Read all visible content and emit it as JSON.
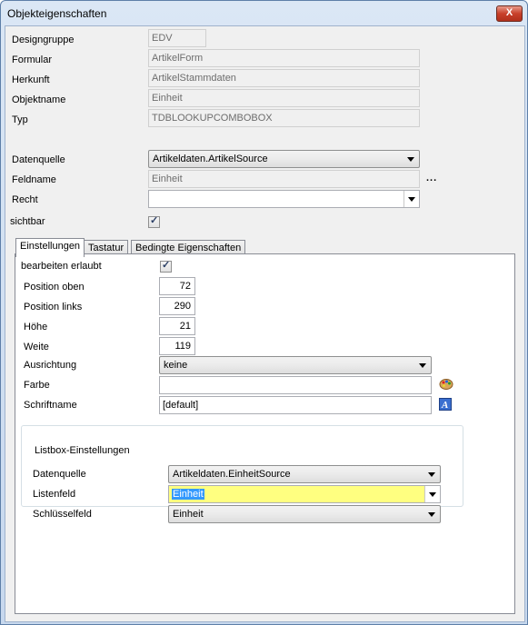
{
  "window": {
    "title": "Objekteigenschaften",
    "close": "X"
  },
  "props": {
    "designgruppe": {
      "label": "Designgruppe",
      "value": "EDV"
    },
    "formular": {
      "label": "Formular",
      "value": "ArtikelForm"
    },
    "herkunft": {
      "label": "Herkunft",
      "value": "ArtikelStammdaten"
    },
    "objektname": {
      "label": "Objektname",
      "value": "Einheit"
    },
    "typ": {
      "label": "Typ",
      "value": "TDBLOOKUPCOMBOBOX"
    },
    "datenquelle": {
      "label": "Datenquelle",
      "value": "Artikeldaten.ArtikelSource"
    },
    "feldname": {
      "label": "Feldname",
      "value": "Einheit",
      "ellipsis": "..."
    },
    "recht": {
      "label": "Recht",
      "value": ""
    },
    "sichtbar": {
      "label": "sichtbar",
      "checked": true
    }
  },
  "tabs": [
    {
      "label": "Einstellungen",
      "active": true
    },
    {
      "label": "Tastatur",
      "active": false
    },
    {
      "label": "Bedingte Eigenschaften",
      "active": false
    }
  ],
  "settings": {
    "bearbeiten": {
      "label": "bearbeiten erlaubt",
      "checked": true
    },
    "position_oben": {
      "label": "Position oben",
      "value": "72"
    },
    "position_links": {
      "label": "Position links",
      "value": "290"
    },
    "hoehe": {
      "label": "Höhe",
      "value": "21"
    },
    "weite": {
      "label": "Weite",
      "value": "119"
    },
    "ausrichtung": {
      "label": "Ausrichtung",
      "value": "keine"
    },
    "farbe": {
      "label": "Farbe",
      "value": "",
      "icon": "palette-icon"
    },
    "schriftname": {
      "label": "Schriftname",
      "value": "[default]",
      "icon": "font-icon"
    }
  },
  "listbox": {
    "title": "Listbox-Einstellungen",
    "datenquelle": {
      "label": "Datenquelle",
      "value": "Artikeldaten.EinheitSource"
    },
    "listenfeld": {
      "label": "Listenfeld",
      "value": "Einheit"
    },
    "schluesselfeld": {
      "label": "Schlüsselfeld",
      "value": "Einheit"
    }
  },
  "colors": {
    "highlight": "#ffff80",
    "selection": "#3399ff",
    "titlebar": "#c7d8ee"
  }
}
